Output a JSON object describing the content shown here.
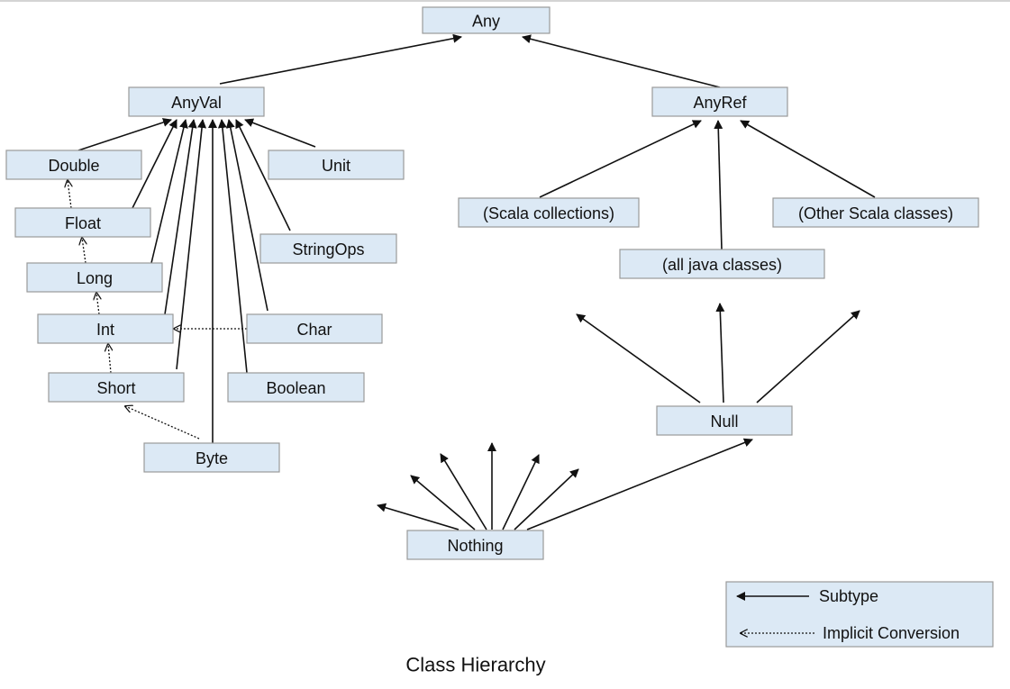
{
  "title": "Class Hierarchy",
  "nodes": {
    "any": "Any",
    "anyval": "AnyVal",
    "anyref": "AnyRef",
    "double": "Double",
    "float": "Float",
    "long": "Long",
    "int": "Int",
    "short": "Short",
    "byte": "Byte",
    "unit": "Unit",
    "stringops": "StringOps",
    "char": "Char",
    "boolean": "Boolean",
    "scala_collections": "(Scala collections)",
    "java_classes": "(all java classes)",
    "other_scala": "(Other Scala classes)",
    "null": "Null",
    "nothing": "Nothing"
  },
  "edges": {
    "subtype": [
      [
        "anyval",
        "any"
      ],
      [
        "anyref",
        "any"
      ],
      [
        "double",
        "anyval"
      ],
      [
        "float",
        "anyval"
      ],
      [
        "long",
        "anyval"
      ],
      [
        "int",
        "anyval"
      ],
      [
        "short",
        "anyval"
      ],
      [
        "byte",
        "anyval"
      ],
      [
        "boolean",
        "anyval"
      ],
      [
        "char",
        "anyval"
      ],
      [
        "stringops",
        "anyval"
      ],
      [
        "unit",
        "anyval"
      ],
      [
        "scala_collections",
        "anyref"
      ],
      [
        "java_classes",
        "anyref"
      ],
      [
        "other_scala",
        "anyref"
      ],
      [
        "null",
        "scala_collections"
      ],
      [
        "null",
        "java_classes"
      ],
      [
        "null",
        "other_scala"
      ],
      [
        "nothing",
        "anyval-subtypes"
      ],
      [
        "nothing",
        "null"
      ]
    ],
    "implicit_conversion": [
      [
        "float",
        "double"
      ],
      [
        "long",
        "float"
      ],
      [
        "int",
        "long"
      ],
      [
        "short",
        "int"
      ],
      [
        "char",
        "int"
      ],
      [
        "byte",
        "short"
      ]
    ]
  },
  "legend": {
    "subtype": "Subtype",
    "implicit": "Implicit Conversion"
  },
  "colors": {
    "node_fill": "#dce9f5",
    "node_border": "#9a9a9a",
    "line": "#111111"
  }
}
